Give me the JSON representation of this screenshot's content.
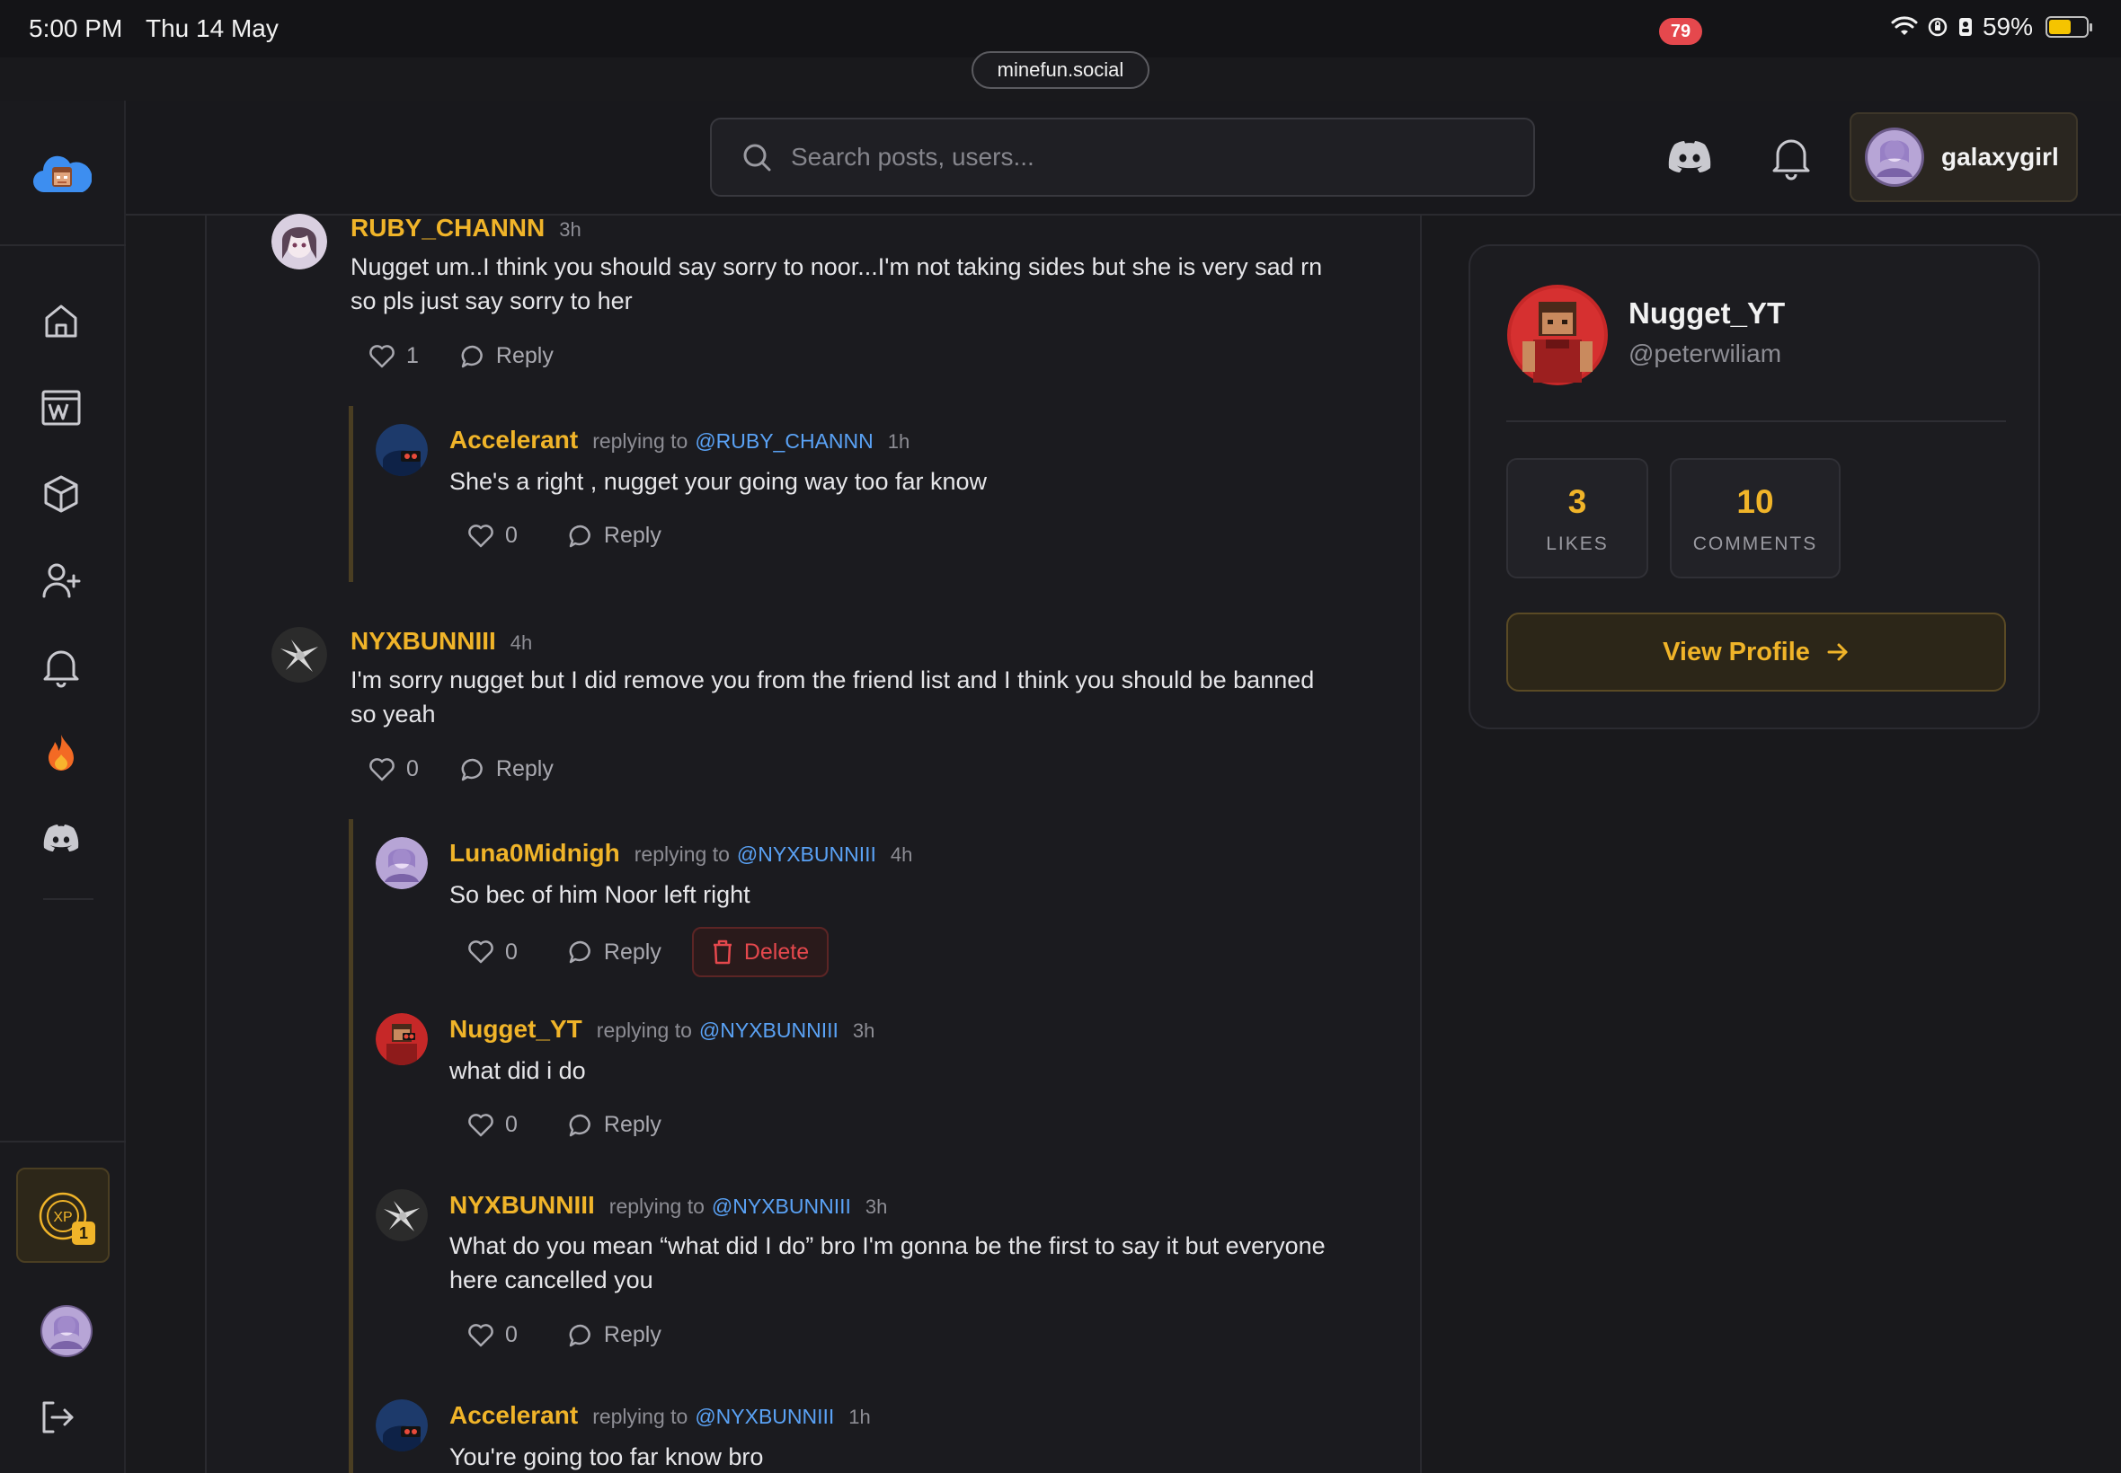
{
  "status_bar": {
    "time": "5:00 PM",
    "date": "Thu 14 May",
    "battery": "59%"
  },
  "browser": {
    "url": "minefun.social"
  },
  "header": {
    "search_placeholder": "Search posts, users...",
    "notification_count": "79",
    "username": "galaxygirl"
  },
  "sidebar": {
    "items": [
      "home-icon",
      "wiki-icon",
      "cube-icon",
      "add-friend-icon",
      "bell-icon",
      "fire-icon",
      "discord-icon"
    ],
    "xp_level": "1",
    "xp_label": "XP"
  },
  "comments": [
    {
      "user": "RUBY_CHANNN",
      "time": "3h",
      "text_lines": [
        "Nugget um..I think you should say sorry to noor...I'm not taking sides but she is very sad rn",
        "so pls just say sorry to her"
      ],
      "likes": "1",
      "reply_label": "Reply"
    },
    {
      "user": "Accelerant",
      "replying_label": "replying to",
      "replying_to": "@RUBY_CHANNN",
      "time": "1h",
      "text_lines": [
        "She's a right , nugget your going way too far know"
      ],
      "likes": "0",
      "reply_label": "Reply"
    },
    {
      "user": "NYXBUNNIII",
      "time": "4h",
      "text_lines": [
        "I'm sorry nugget but I did remove you from the friend list and I think you should be banned",
        "so yeah"
      ],
      "likes": "0",
      "reply_label": "Reply"
    },
    {
      "user": "Luna0Midnigh",
      "replying_label": "replying to",
      "replying_to": "@NYXBUNNIII",
      "time": "4h",
      "text_lines": [
        "So bec of him Noor left right"
      ],
      "likes": "0",
      "reply_label": "Reply",
      "delete_label": "Delete"
    },
    {
      "user": "Nugget_YT",
      "replying_label": "replying to",
      "replying_to": "@NYXBUNNIII",
      "time": "3h",
      "text_lines": [
        "what did i do"
      ],
      "likes": "0",
      "reply_label": "Reply"
    },
    {
      "user": "NYXBUNNIII",
      "replying_label": "replying to",
      "replying_to": "@NYXBUNNIII",
      "time": "3h",
      "text_lines": [
        "What do you mean “what did I do” bro I'm gonna be the first to say it but everyone",
        "here cancelled you"
      ],
      "likes": "0",
      "reply_label": "Reply"
    },
    {
      "user": "Accelerant",
      "replying_label": "replying to",
      "replying_to": "@NYXBUNNIII",
      "time": "1h",
      "text_lines": [
        "You're going too far know bro"
      ]
    }
  ],
  "profile_card": {
    "name": "Nugget_YT",
    "handle": "@peterwiliam",
    "likes_count": "3",
    "likes_label": "LIKES",
    "comments_count": "10",
    "comments_label": "COMMENTS",
    "view_profile_label": "View Profile"
  },
  "colors": {
    "accent": "#f0b429",
    "mention": "#5aa2f5",
    "danger": "#e5484d",
    "background": "#19191c"
  }
}
